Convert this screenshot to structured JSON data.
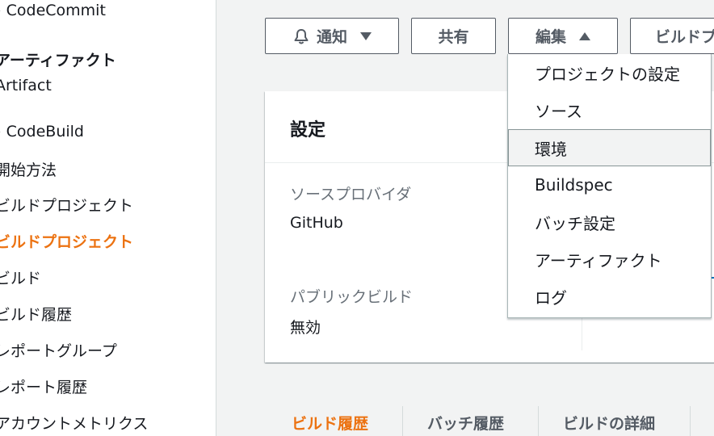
{
  "sidebar": {
    "items": [
      {
        "label": "› CodeCommit"
      },
      {
        "label": "アーティファクト"
      },
      {
        "label": "Artifact"
      },
      {
        "label": "› CodeBuild"
      },
      {
        "label": "開始方法"
      },
      {
        "label": "ビルドプロジェクト"
      },
      {
        "label": "ビルドプロジェクト"
      },
      {
        "label": "ビルド"
      },
      {
        "label": "ビルド履歴"
      },
      {
        "label": "レポートグループ"
      },
      {
        "label": "レポート履歴"
      },
      {
        "label": "アカウントメトリクス"
      }
    ]
  },
  "toolbar": {
    "notify_label": "通知",
    "share_label": "共有",
    "edit_label": "編集",
    "build_label": "ビルドプ"
  },
  "panel": {
    "title": "設定",
    "source_provider_label": "ソースプロバイダ",
    "source_provider_value": "GitHub",
    "public_build_label": "パブリックビルド",
    "public_build_value": "無効"
  },
  "edit_menu": {
    "items": [
      {
        "label": "プロジェクトの設定"
      },
      {
        "label": "ソース"
      },
      {
        "label": "環境"
      },
      {
        "label": "Buildspec"
      },
      {
        "label": "バッチ設定"
      },
      {
        "label": "アーティファクト"
      },
      {
        "label": "ログ"
      }
    ],
    "hovered_index": 2
  },
  "tabs": [
    {
      "label": "ビルド履歴",
      "active": true
    },
    {
      "label": "バッチ履歴",
      "active": false
    },
    {
      "label": "ビルドの詳細",
      "active": false
    }
  ],
  "colors": {
    "accent": "#ec7211",
    "text": "#16191f",
    "muted": "#687078",
    "button_border": "#545b64"
  }
}
